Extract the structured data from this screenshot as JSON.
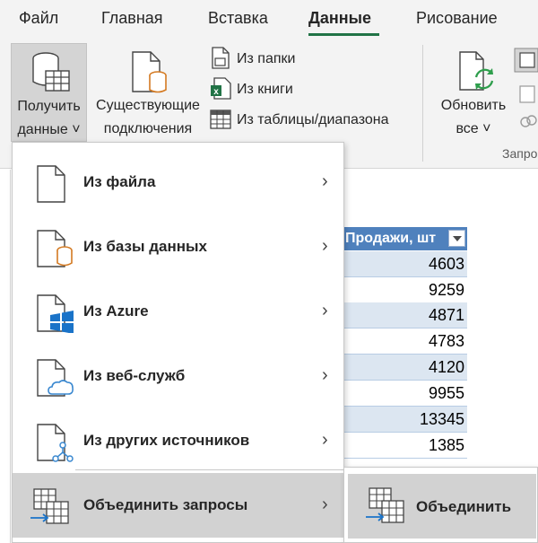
{
  "menubar": {
    "tabs": [
      {
        "label": "Файл"
      },
      {
        "label": "Главная"
      },
      {
        "label": "Вставка"
      },
      {
        "label": "Данные"
      },
      {
        "label": "Рисование"
      }
    ],
    "active_tab": "Данные"
  },
  "ribbon": {
    "get_data": {
      "line1": "Получить",
      "line2": "данные ˅"
    },
    "existing": {
      "line1": "Существующие",
      "line2": "подключения"
    },
    "from_folder": "Из папки",
    "from_book": "Из книги",
    "from_table": "Из таблицы/диапазона",
    "refresh": {
      "line1": "Обновить",
      "line2": "все ˅"
    },
    "queries_group": "Запро"
  },
  "table": {
    "header": "Продажи, шт",
    "values": [
      "4603",
      "9259",
      "4871",
      "4783",
      "4120",
      "9955",
      "13345",
      "1385"
    ]
  },
  "dropdown": {
    "items": [
      {
        "label": "Из файла",
        "icon": "file-icon"
      },
      {
        "label": "Из базы данных",
        "icon": "database-icon"
      },
      {
        "label": "Из Azure",
        "icon": "azure-icon"
      },
      {
        "label": "Из веб-служб",
        "icon": "cloud-icon"
      },
      {
        "label": "Из других источников",
        "icon": "network-icon"
      },
      {
        "label": "Объединить запросы",
        "icon": "combine-icon"
      }
    ]
  },
  "submenu": {
    "item": "Объединить"
  },
  "colors": {
    "accent": "#217346",
    "table_header": "#4f81bd",
    "band": "#dce6f1",
    "highlight": "#d2d2d2"
  }
}
